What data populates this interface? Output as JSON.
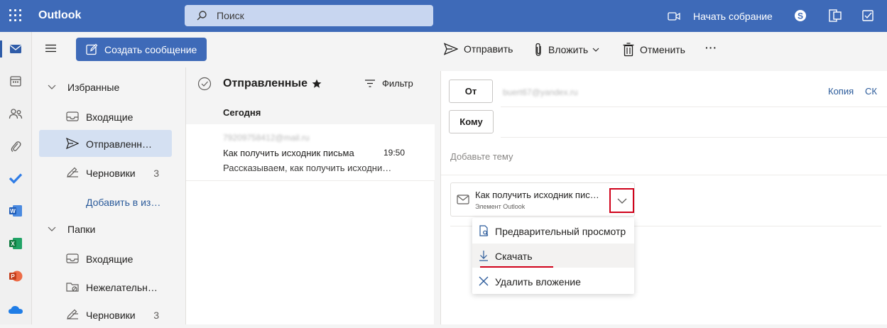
{
  "topbar": {
    "app_title": "Outlook",
    "search_placeholder": "Поиск",
    "meet_label": "Начать собрание"
  },
  "toolbar": {
    "new_message": "Создать сообщение",
    "send": "Отправить",
    "attach": "Вложить",
    "discard": "Отменить",
    "more": "···"
  },
  "folders": {
    "favorites_label": "Избранные",
    "favorites": [
      {
        "label": "Входящие",
        "count": ""
      },
      {
        "label": "Отправленн…",
        "count": ""
      },
      {
        "label": "Черновики",
        "count": "3"
      }
    ],
    "add_favorite": "Добавить в из…",
    "folders_label": "Папки",
    "folders": [
      {
        "label": "Входящие",
        "count": ""
      },
      {
        "label": "Нежелательн…",
        "count": ""
      },
      {
        "label": "Черновики",
        "count": "3"
      }
    ]
  },
  "message_list": {
    "title": "Отправленные",
    "filter": "Фильтр",
    "group_today": "Сегодня",
    "items": [
      {
        "from": "79209758412@mail.ru",
        "subject": "Как получить исходник письма",
        "time": "19:50",
        "preview": "Рассказываем, как получить исходни…"
      }
    ]
  },
  "compose": {
    "from_button": "От",
    "from_value": "buert67@yandex.ru",
    "to_button": "Кому",
    "cc": "Копия",
    "bcc": "СК",
    "subject_placeholder": "Добавьте тему",
    "attachment": {
      "name": "Как получить исходник пис…",
      "type": "Элемент Outlook"
    }
  },
  "attachment_menu": {
    "items": [
      {
        "label": "Предварительный просмотр"
      },
      {
        "label": "Скачать"
      },
      {
        "label": "Удалить вложение"
      }
    ]
  },
  "colors": {
    "brand": "#3e6ab8",
    "highlight": "#d0021b",
    "selected_folder": "#d4e0f2"
  }
}
